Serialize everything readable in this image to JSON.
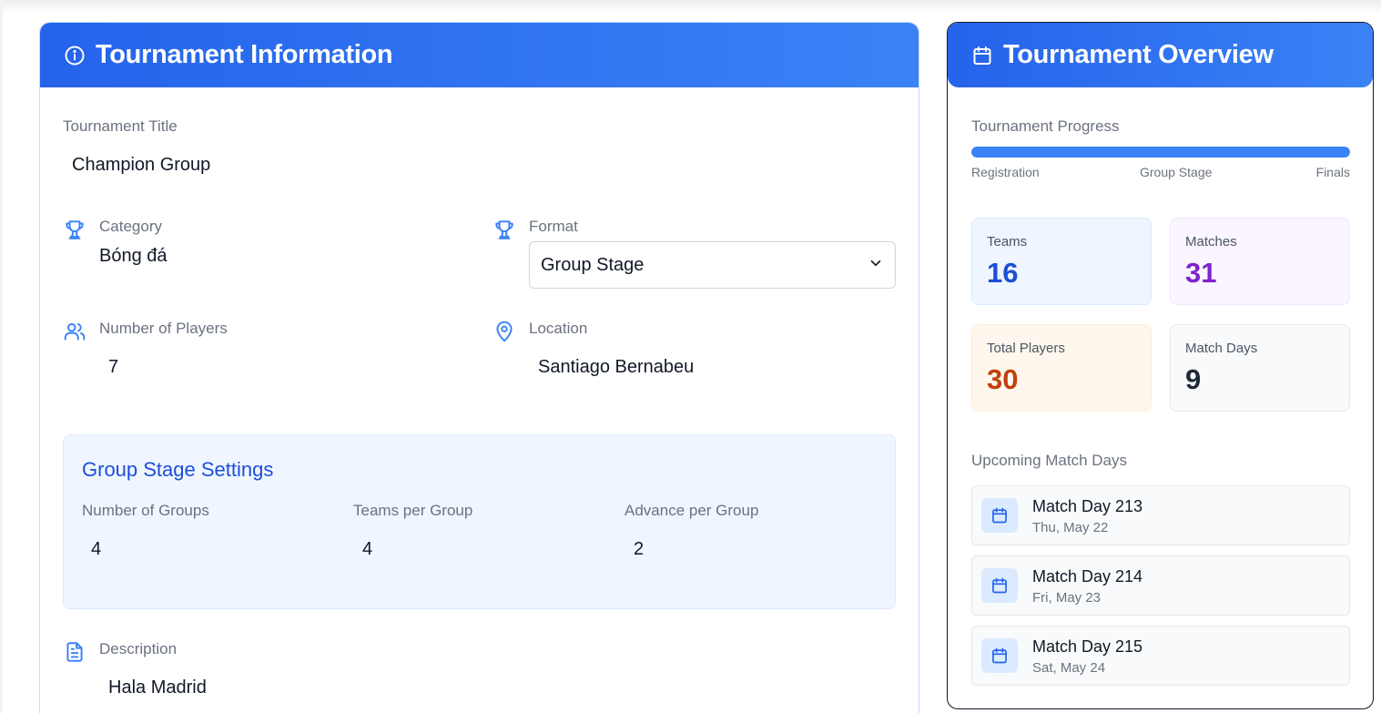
{
  "tournament_info": {
    "header_title": "Tournament Information",
    "title_label": "Tournament Title",
    "title_value": "Champion Group",
    "category_label": "Category",
    "category_value": "Bóng đá",
    "format_label": "Format",
    "format_value": "Group Stage",
    "players_label": "Number of Players",
    "players_value": "7",
    "location_label": "Location",
    "location_value": "Santiago Bernabeu",
    "group_settings": {
      "title": "Group Stage Settings",
      "groups_label": "Number of Groups",
      "groups_value": "4",
      "teams_label": "Teams per Group",
      "teams_value": "4",
      "advance_label": "Advance per Group",
      "advance_value": "2"
    },
    "description_label": "Description",
    "description_value": "Hala Madrid"
  },
  "overview": {
    "header_title": "Tournament Overview",
    "progress_label": "Tournament Progress",
    "progress_value": 1.0,
    "progress_steps": [
      "Registration",
      "Group Stage",
      "Finals"
    ],
    "stats": {
      "teams_label": "Teams",
      "teams_value": "16",
      "matches_label": "Matches",
      "matches_value": "31",
      "players_label": "Total Players",
      "players_value": "30",
      "days_label": "Match Days",
      "days_value": "9"
    },
    "upcoming_label": "Upcoming Match Days",
    "match_days": [
      {
        "title": "Match Day 213",
        "date": "Thu, May 22"
      },
      {
        "title": "Match Day 214",
        "date": "Fri, May 23"
      },
      {
        "title": "Match Day 215",
        "date": "Sat, May 24"
      }
    ]
  },
  "colors": {
    "header_gradient_start": "#2563eb",
    "header_gradient_end": "#3b82f6",
    "teams_accent": "#1d4ed8",
    "matches_accent": "#7e22ce",
    "players_accent": "#c2410c",
    "days_accent": "#1f2937"
  },
  "icons": {
    "info": "info-circle-icon",
    "calendar": "calendar-icon",
    "trophy": "trophy-icon",
    "users": "users-icon",
    "location": "map-pin-icon",
    "document": "document-icon",
    "chevron": "chevron-down-icon"
  }
}
